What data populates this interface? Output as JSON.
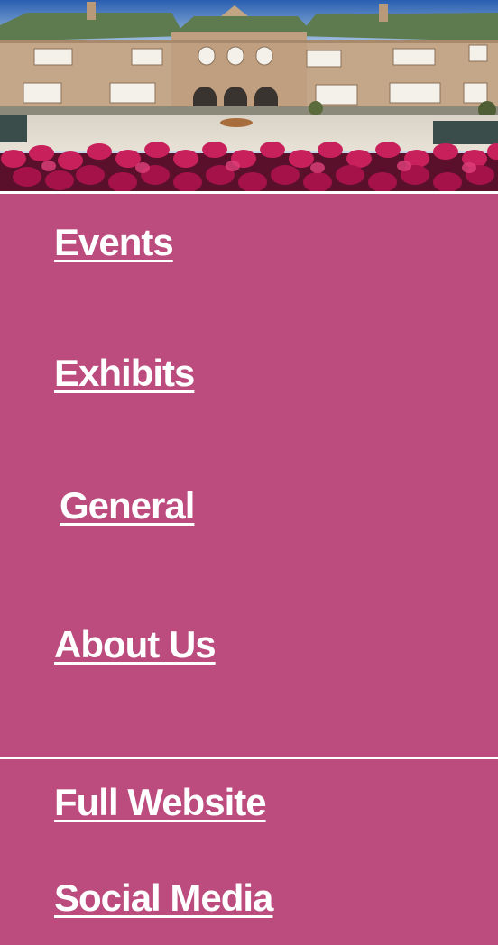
{
  "header": {
    "image_alt": "",
    "icon": "building-photo"
  },
  "menu": {
    "items": [
      {
        "label": "Events"
      },
      {
        "label": "Exhibits"
      },
      {
        "label": "General"
      },
      {
        "label": "About Us"
      }
    ]
  },
  "footer": {
    "items": [
      {
        "label": "Full Website"
      },
      {
        "label": "Social Media"
      }
    ]
  },
  "colors": {
    "background": "#bb4c7d",
    "text": "#ffffff",
    "divider": "#ffffff"
  }
}
